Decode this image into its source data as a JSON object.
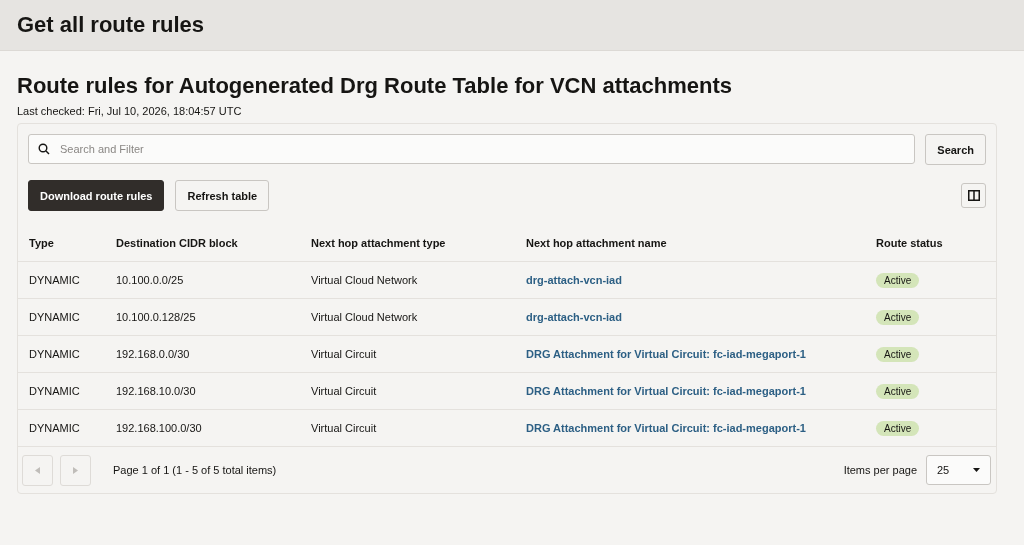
{
  "page_title": "Get all route rules",
  "section": {
    "title": "Route rules for Autogenerated Drg Route Table for VCN attachments",
    "last_checked": "Last checked: Fri, Jul 10, 2026, 18:04:57 UTC"
  },
  "search": {
    "placeholder": "Search and Filter",
    "button": "Search"
  },
  "actions": [
    {
      "label": "Download route rules",
      "kind": "primary"
    },
    {
      "label": "Refresh table",
      "kind": "secondary"
    }
  ],
  "table": {
    "columns": [
      "Type",
      "Destination CIDR block",
      "Next hop attachment type",
      "Next hop attachment name",
      "Route status"
    ],
    "rows": [
      {
        "type": "DYNAMIC",
        "cidr": "10.100.0.0/25",
        "hop_type": "Virtual Cloud Network",
        "hop_name": "drg-attach-vcn-iad",
        "status": "Active"
      },
      {
        "type": "DYNAMIC",
        "cidr": "10.100.0.128/25",
        "hop_type": "Virtual Cloud Network",
        "hop_name": "drg-attach-vcn-iad",
        "status": "Active"
      },
      {
        "type": "DYNAMIC",
        "cidr": "192.168.0.0/30",
        "hop_type": "Virtual Circuit",
        "hop_name": "DRG Attachment for Virtual Circuit: fc-iad-megaport-1",
        "status": "Active"
      },
      {
        "type": "DYNAMIC",
        "cidr": "192.168.10.0/30",
        "hop_type": "Virtual Circuit",
        "hop_name": "DRG Attachment for Virtual Circuit: fc-iad-megaport-1",
        "status": "Active"
      },
      {
        "type": "DYNAMIC",
        "cidr": "192.168.100.0/30",
        "hop_type": "Virtual Circuit",
        "hop_name": "DRG Attachment for Virtual Circuit: fc-iad-megaport-1",
        "status": "Active"
      }
    ]
  },
  "pagination": {
    "prev_disabled": true,
    "next_disabled": true,
    "summary": "Page 1 of 1 (1 - 5 of 5 total items)",
    "per_page_label": "Items per page",
    "per_page": "25"
  }
}
